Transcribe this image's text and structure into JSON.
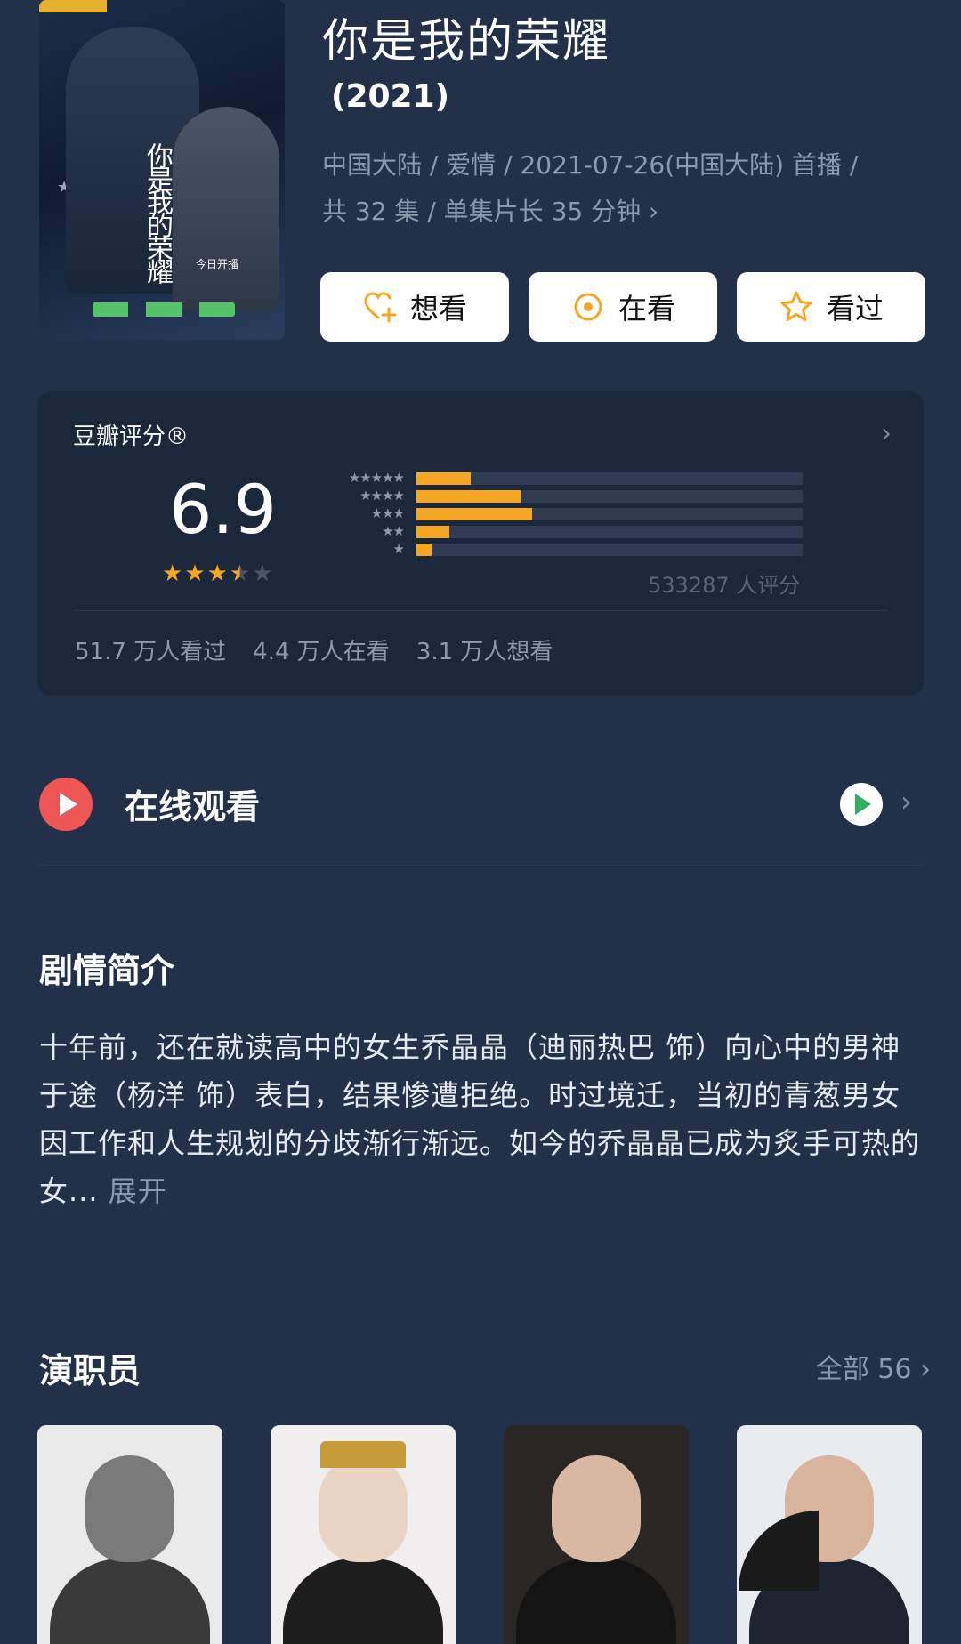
{
  "movie": {
    "title": "你是我的荣耀",
    "year": "(2021)",
    "meta_line1": "中国大陆 / 爱情 / 2021-07-26(中国大陆) 首播 /",
    "meta_line2": "共 32 集 / 单集片长 35 分钟 ›",
    "poster": {
      "calligraphy": "你是我的荣耀",
      "open_today": "今日开播"
    }
  },
  "actions": [
    {
      "label": "想看",
      "icon": "heart-plus-icon",
      "color": "#f5a623"
    },
    {
      "label": "在看",
      "icon": "target-circle-icon",
      "color": "#f5a623"
    },
    {
      "label": "看过",
      "icon": "star-outline-icon",
      "color": "#f5a623"
    }
  ],
  "rating": {
    "label": "豆瓣评分®",
    "chevron": "›",
    "score": "6.9",
    "stars_filled": 3.5,
    "stars_total": 5,
    "distribution": [
      {
        "stars": "★★★★★",
        "fraction": 0.14
      },
      {
        "stars": "★★★★",
        "fraction": 0.27
      },
      {
        "stars": "★★★",
        "fraction": 0.3
      },
      {
        "stars": "★★",
        "fraction": 0.085
      },
      {
        "stars": "★",
        "fraction": 0.04
      }
    ],
    "count": "533287 人评分",
    "stats": [
      "51.7 万人看过",
      "4.4 万人在看",
      "3.1 万人想看"
    ],
    "accent": "#f5a623"
  },
  "watch": {
    "label": "在线观看",
    "play_icon_color": "#ee5656",
    "platform_icon": "tencent-video-icon",
    "chevron": "›"
  },
  "synopsis": {
    "title": "剧情简介",
    "text": "十年前，还在就读高中的女生乔晶晶（迪丽热巴 饰）向心中的男神于途（杨洋 饰）表白，结果惨遭拒绝。时过境迁，当初的青葱男女因工作和人生规划的分歧渐行渐远。如今的乔晶晶已成为炙手可热的女...",
    "expand": "展开"
  },
  "cast": {
    "title": "演职员",
    "all_label": "全部 56 ›"
  }
}
